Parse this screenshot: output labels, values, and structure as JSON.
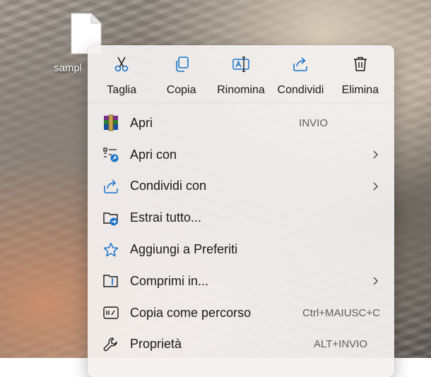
{
  "desktop": {
    "file_label": "sampl"
  },
  "action_bar": [
    {
      "name": "cut",
      "label": "Taglia",
      "icon": "scissors-icon"
    },
    {
      "name": "copy",
      "label": "Copia",
      "icon": "copy-icon"
    },
    {
      "name": "rename",
      "label": "Rinomina",
      "icon": "rename-icon"
    },
    {
      "name": "share",
      "label": "Condividi",
      "icon": "share-icon"
    },
    {
      "name": "delete",
      "label": "Elimina",
      "icon": "trash-icon"
    }
  ],
  "menu_items": [
    {
      "label": "Apri",
      "shortcut": "INVIO",
      "icon": "winrar-icon",
      "submenu": false
    },
    {
      "label": "Apri con",
      "shortcut": "",
      "icon": "open-with-icon",
      "submenu": true
    },
    {
      "label": "Condividi con",
      "shortcut": "",
      "icon": "share-icon",
      "submenu": true
    },
    {
      "label": "Estrai tutto...",
      "shortcut": "",
      "icon": "extract-folder-icon",
      "submenu": false
    },
    {
      "label": "Aggiungi a Preferiti",
      "shortcut": "",
      "icon": "star-icon",
      "submenu": false
    },
    {
      "label": "Comprimi in...",
      "shortcut": "",
      "icon": "zip-folder-icon",
      "submenu": true
    },
    {
      "label": "Copia come percorso",
      "shortcut": "Ctrl+MAIUSC+C",
      "icon": "copy-path-icon",
      "submenu": false
    },
    {
      "label": "Proprietà",
      "shortcut": "ALT+INVIO",
      "icon": "wrench-icon",
      "submenu": false
    }
  ],
  "colors": {
    "accent": "#1a73c9",
    "menu_background": "#f4f1f0"
  }
}
